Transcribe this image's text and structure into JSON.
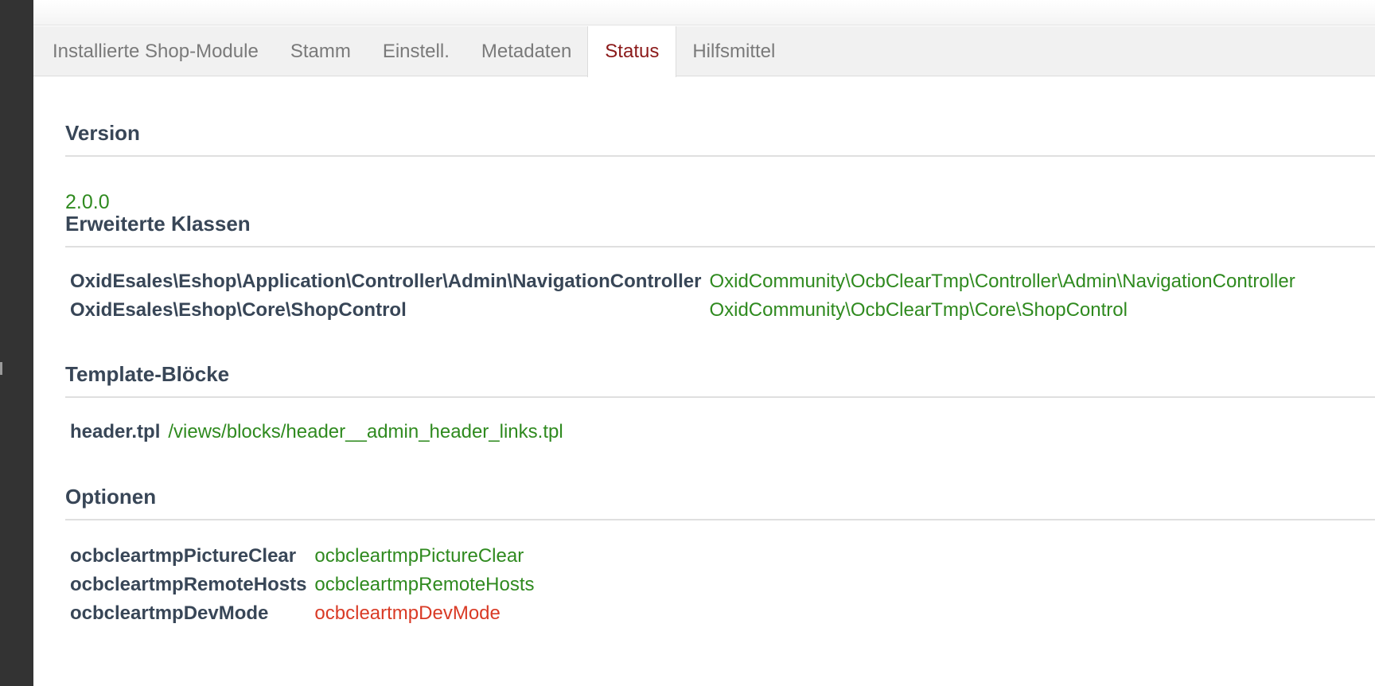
{
  "tabs": [
    {
      "label": "Installierte Shop-Module",
      "active": false
    },
    {
      "label": "Stamm",
      "active": false
    },
    {
      "label": "Einstell.",
      "active": false
    },
    {
      "label": "Metadaten",
      "active": false
    },
    {
      "label": "Status",
      "active": true
    },
    {
      "label": "Hilfsmittel",
      "active": false
    }
  ],
  "version": {
    "title": "Version",
    "value": "2.0.0"
  },
  "extended_classes": {
    "title": "Erweiterte Klassen",
    "rows": [
      {
        "key": "OxidEsales\\Eshop\\Application\\Controller\\Admin\\NavigationController",
        "value": "OxidCommunity\\OcbClearTmp\\Controller\\Admin\\NavigationController"
      },
      {
        "key": "OxidEsales\\Eshop\\Core\\ShopControl",
        "value": "OxidCommunity\\OcbClearTmp\\Core\\ShopControl"
      }
    ]
  },
  "template_blocks": {
    "title": "Template-Blöcke",
    "rows": [
      {
        "key": "header.tpl",
        "value": "/views/blocks/header__admin_header_links.tpl"
      }
    ]
  },
  "options": {
    "title": "Optionen",
    "rows": [
      {
        "key": "ocbcleartmpPictureClear",
        "value": "ocbcleartmpPictureClear",
        "ok": true
      },
      {
        "key": "ocbcleartmpRemoteHosts",
        "value": "ocbcleartmpRemoteHosts",
        "ok": true
      },
      {
        "key": "ocbcleartmpDevMode",
        "value": "ocbcleartmpDevMode",
        "ok": false
      }
    ]
  },
  "colors": {
    "ok": "#2f8a1f",
    "error": "#d93a25",
    "active_tab": "#8b1a1a",
    "heading": "#384657"
  }
}
